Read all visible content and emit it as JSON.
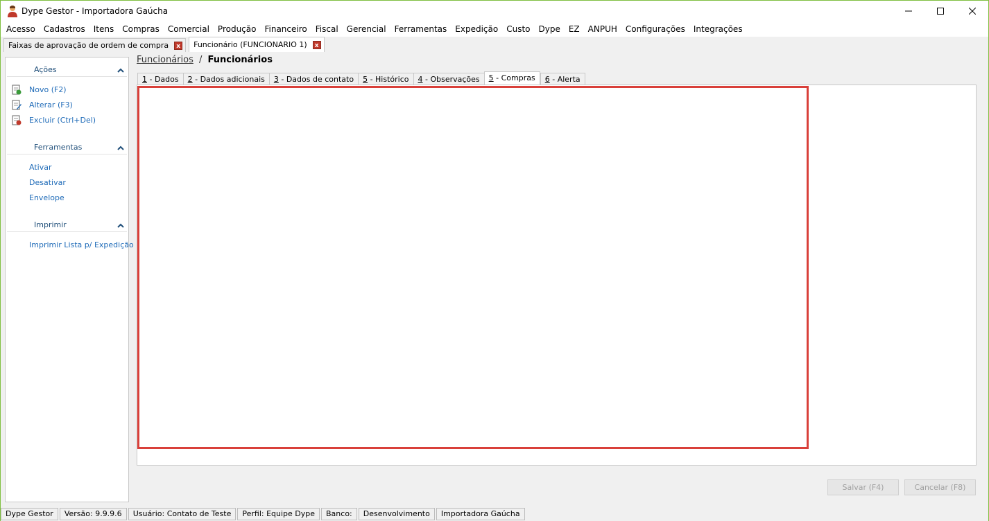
{
  "window": {
    "title": "Dype Gestor - Importadora Gaúcha"
  },
  "menu": [
    "Acesso",
    "Cadastros",
    "Itens",
    "Compras",
    "Comercial",
    "Produção",
    "Financeiro",
    "Fiscal",
    "Gerencial",
    "Ferramentas",
    "Expedição",
    "Custo",
    "Dype",
    "EZ",
    "ANPUH",
    "Configurações",
    "Integrações"
  ],
  "doc_tabs": [
    {
      "label": "Faixas de aprovação de ordem de compra",
      "active": false
    },
    {
      "label": "Funcionário (FUNCIONARIO 1)",
      "active": true
    }
  ],
  "sidebar": {
    "acoes": {
      "title": "Ações",
      "items": [
        "Novo (F2)",
        "Alterar (F3)",
        "Excluir (Ctrl+Del)"
      ]
    },
    "ferramentas": {
      "title": "Ferramentas",
      "items": [
        "Ativar",
        "Desativar",
        "Envelope"
      ]
    },
    "imprimir": {
      "title": "Imprimir",
      "items": [
        "Imprimir Lista p/ Expedição"
      ]
    }
  },
  "breadcrumb": {
    "link": "Funcionários",
    "separator": "/",
    "current": "Funcionários"
  },
  "page_tabs": [
    {
      "key": "1",
      "rest": " - Dados",
      "active": false
    },
    {
      "key": "2",
      "rest": " - Dados adicionais",
      "active": false
    },
    {
      "key": "3",
      "rest": " - Dados de contato",
      "active": false
    },
    {
      "key": "5",
      "rest": " - Histórico",
      "active": false
    },
    {
      "key": "4",
      "rest": " - Observações",
      "active": false
    },
    {
      "key": "5",
      "rest": " - Compras",
      "active": true
    },
    {
      "key": "6",
      "rest": " - Alerta",
      "active": false
    }
  ],
  "buttons": {
    "save": "Salvar (F4)",
    "cancel": "Cancelar (F8)"
  },
  "status": [
    "Dype Gestor",
    "Versão: 9.9.9.6",
    "Usuário: Contato de Teste",
    "Perfil: Equipe Dype",
    "Banco:",
    "Desenvolvimento",
    "Importadora Gaúcha"
  ],
  "colors": {
    "highlight": "#d9403a",
    "link": "#1f6bb8",
    "section": "#1f4e79"
  }
}
